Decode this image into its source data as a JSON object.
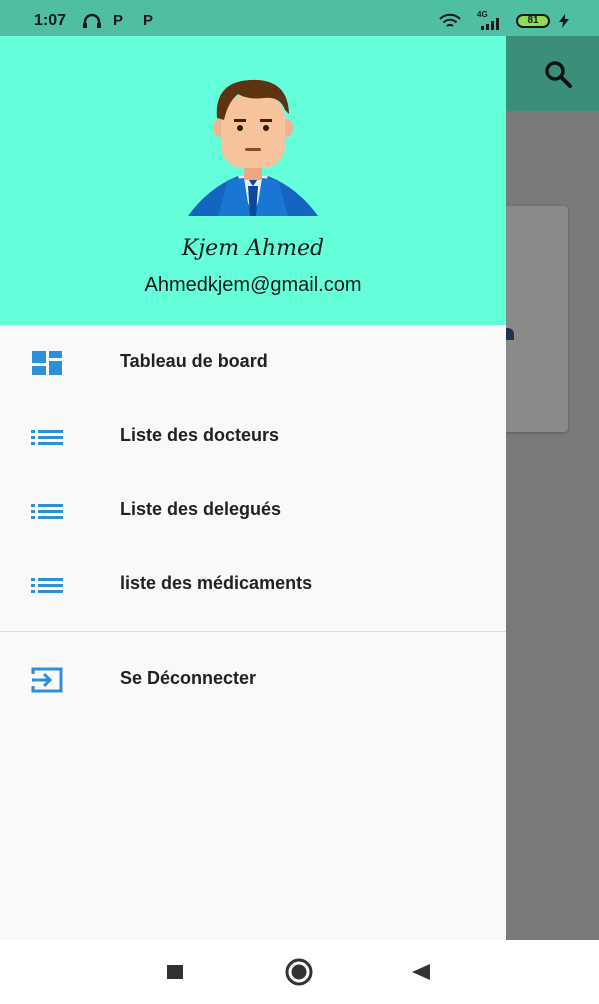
{
  "status_bar": {
    "time": "1:07",
    "icons": [
      "headphones-icon",
      "p-app-icon",
      "p-app-icon",
      "wifi-icon",
      "signal-icon",
      "charging-icon"
    ],
    "p1": "P",
    "p2": "P",
    "network": "4G",
    "battery": "81"
  },
  "drawer": {
    "header": {
      "user_name": "Kjem Ahmed",
      "user_email": "Ahmedkjem@gmail.com",
      "color": "#64ffda"
    },
    "items": [
      {
        "label": "Tableau de board",
        "icon": "dashboard-icon"
      },
      {
        "label": "Liste des docteurs",
        "icon": "list-icon"
      },
      {
        "label": "Liste des delegués",
        "icon": "list-icon"
      },
      {
        "label": "liste des médicaments",
        "icon": "list-icon"
      },
      {
        "label": "Se Déconnecter",
        "icon": "logout-icon"
      }
    ],
    "icon_color": "#2d8fd8"
  },
  "app_bar": {
    "action_icon": "search-icon",
    "color": "#3b8f7a"
  },
  "nav_bar": {
    "buttons": [
      "recents-icon",
      "home-icon",
      "back-icon"
    ]
  }
}
